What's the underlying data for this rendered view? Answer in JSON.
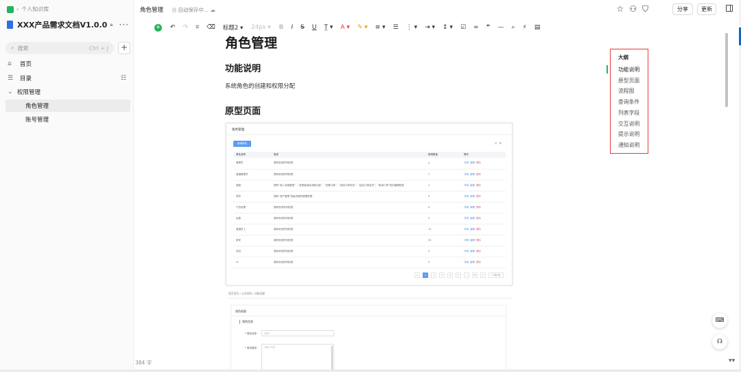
{
  "sidebar": {
    "breadcrumb": "个人知识库",
    "book_title": "XXX产品需求文档V1.0.0",
    "search_placeholder": "搜索",
    "search_shortcut": "Ctrl + J",
    "nav": [
      {
        "label": "首页"
      },
      {
        "label": "目录"
      },
      {
        "label": "权限管理"
      },
      {
        "label": "角色管理"
      },
      {
        "label": "账号管理"
      }
    ]
  },
  "header": {
    "doc_title": "角色管理",
    "save_status": "自动保存中...",
    "share_label": "分享",
    "update_label": "更新"
  },
  "toolbar": {
    "heading_select": "标题2",
    "font_size": "24px"
  },
  "doc": {
    "title": "角色管理",
    "section1_title": "功能说明",
    "section1_text": "系统角色的创建和权限分配",
    "section2_title": "原型页面"
  },
  "prototype": {
    "page_title": "角色管理",
    "new_button": "新增角色",
    "table_headers": [
      "角色名称",
      "描述",
      "使用数量",
      "操作"
    ],
    "rows": [
      {
        "name": "管理员",
        "desc": "拥有系统所有权限",
        "count": "0"
      },
      {
        "name": "普通管理员",
        "desc": "拥有系统所有权限",
        "count": "1"
      },
      {
        "name": "客服",
        "desc": "拥有“录入待报数据”，“查看各级待流程分组”，“查看订单”，“批改订单状态”，“延迟订单发货”，“取消订单”的的编辑权限",
        "count": "2"
      },
      {
        "name": "财务",
        "desc": "拥有“资产管理”各级流程的管理权限",
        "count": "0"
      },
      {
        "name": "产品经理",
        "desc": "拥有系统所有权限",
        "count": "4"
      },
      {
        "name": "运营",
        "desc": "拥有系统所有权限",
        "count": "3"
      },
      {
        "name": "普通员工",
        "desc": "拥有系统所有权限",
        "count": "12"
      },
      {
        "name": "研发",
        "desc": "拥有系统所有权限",
        "count": "30"
      },
      {
        "name": "测试",
        "desc": "拥有系统所有权限",
        "count": "5"
      },
      {
        "name": "UI",
        "desc": "拥有系统所有权限",
        "count": "3"
      }
    ],
    "row_actions": [
      "详情",
      "编辑",
      "删除"
    ],
    "pager": [
      "<",
      "1",
      "2",
      "3",
      "4",
      "5",
      "...",
      "10",
      ">",
      "10条/页"
    ],
    "crumb2": "首页首页 / 公司架构 / 功能创建",
    "form_title": "角色权限",
    "form_section": "角色信息",
    "field1_label": "* 角色名称:",
    "field1_placeholder": "请输入",
    "field2_label": "* 角色描述:",
    "field2_placeholder": "请输入内容"
  },
  "outline": {
    "title": "大纲",
    "items": [
      "功能说明",
      "原型页面",
      "流程图",
      "查询条件",
      "列表字段",
      "交互说明",
      "提示说明",
      "通知说明"
    ]
  },
  "word_count": "384 字",
  "colors": {
    "accent_green": "#22b35e",
    "outline_border": "#e53935",
    "link_blue": "#5b9df0"
  }
}
